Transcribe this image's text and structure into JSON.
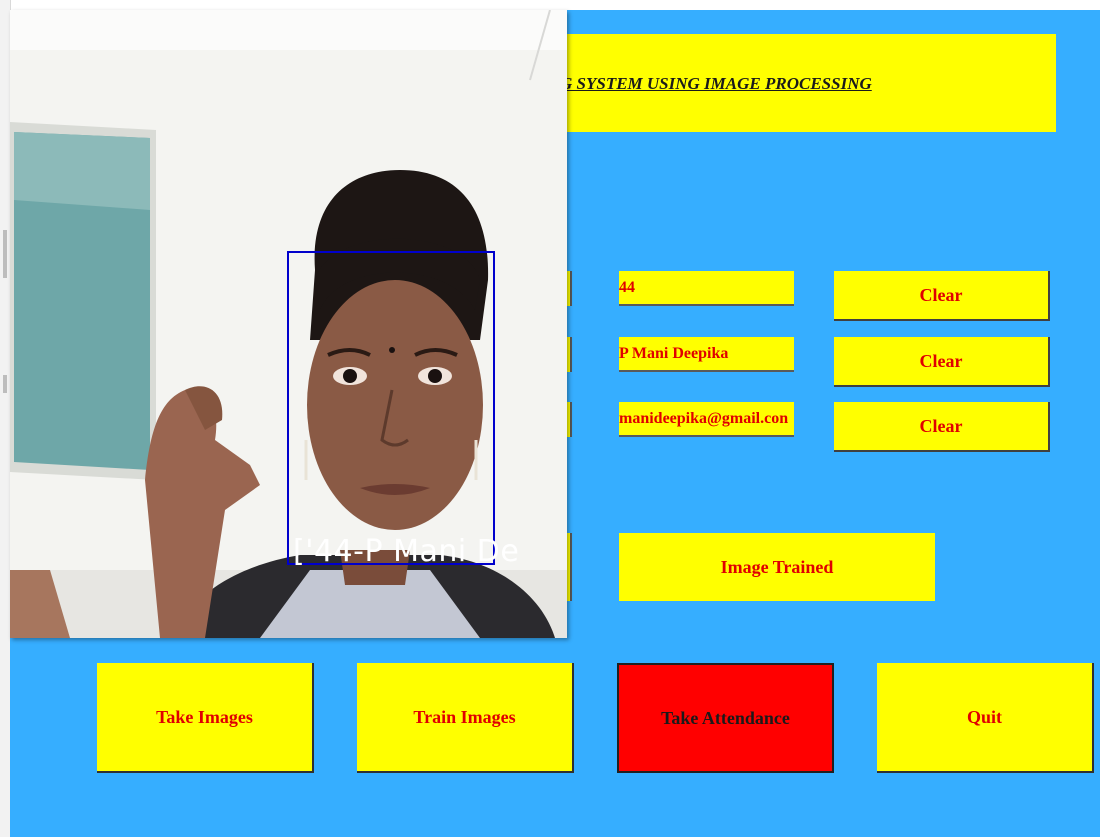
{
  "title": "G SYSTEM USING IMAGE PROCESSING",
  "fields": {
    "id_value": "44",
    "name_value": "P Mani Deepika",
    "email_value": "manideepika@gmail.con"
  },
  "clear_buttons": [
    "Clear",
    "Clear",
    "Clear"
  ],
  "status": "Image Trained",
  "actions": {
    "take_images": "Take Images",
    "train_images": "Train Images",
    "take_attendance": "Take Attendance",
    "quit": "Quit"
  },
  "camera": {
    "overlay_label": "['44-P Mani De"
  },
  "colors": {
    "background": "#36aeff",
    "panel": "#ffff00",
    "text_red": "#e00000",
    "attendance_button": "#ff0000",
    "face_box": "#0000cc"
  }
}
